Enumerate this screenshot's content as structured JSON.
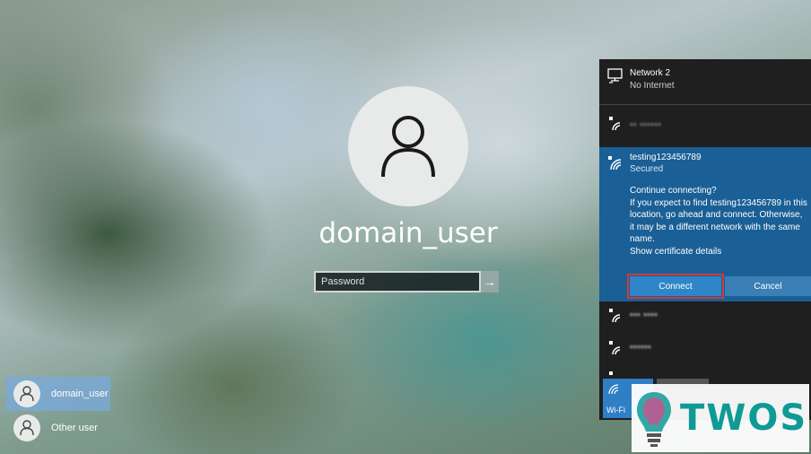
{
  "login": {
    "username": "domain_user",
    "password_placeholder": "Password",
    "submit_icon": "arrow-right-icon"
  },
  "user_list": [
    {
      "name": "domain_user",
      "selected": true
    },
    {
      "name": "Other user",
      "selected": false
    }
  ],
  "network_flyout": {
    "wired": {
      "name": "Network 2",
      "status": "No Internet"
    },
    "networks_above": [
      {
        "name": "•• ••••••",
        "obscured": true
      }
    ],
    "selected_network": {
      "name": "testing123456789",
      "status": "Secured",
      "prompt_title": "Continue connecting?",
      "prompt_body": "If you expect to find testing123456789 in this location, go ahead and connect. Otherwise, it may be a different network with the same name.",
      "cert_link": "Show certificate details",
      "connect_label": "Connect",
      "cancel_label": "Cancel"
    },
    "networks_below": [
      {
        "name": "••• ••••",
        "obscured": true
      },
      {
        "name": "••••••",
        "obscured": true
      }
    ],
    "wifi_tile_label": "Wi-Fi"
  },
  "watermark": {
    "text": "TWOS"
  },
  "colors": {
    "flyout_bg": "#1f1f1f",
    "selected_bg": "#1a5f95",
    "connect_bg": "#2e86c9",
    "highlight_border": "#d23a3a",
    "watermark": "#0f9a96"
  }
}
